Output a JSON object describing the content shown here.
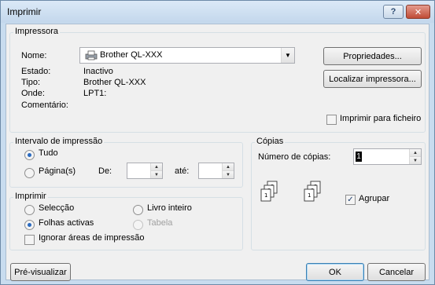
{
  "window": {
    "title": "Imprimir",
    "help_label": "?",
    "close_label": "✕"
  },
  "printer": {
    "group_label": "Impressora",
    "name_label": "Nome:",
    "name_value": "Brother QL-XXX",
    "properties_button": "Propriedades...",
    "find_printer_button": "Localizar impressora...",
    "status_label": "Estado:",
    "status_value": "Inactivo",
    "type_label": "Tipo:",
    "type_value": "Brother QL-XXX",
    "where_label": "Onde:",
    "where_value": "LPT1:",
    "comment_label": "Comentário:",
    "print_to_file_label": "Imprimir para ficheiro",
    "print_to_file_checked": false
  },
  "range": {
    "group_label": "Intervalo de impressão",
    "all_label": "Tudo",
    "all_checked": true,
    "pages_label": "Página(s)",
    "from_label": "De:",
    "from_value": "",
    "to_label": "até:",
    "to_value": ""
  },
  "copies": {
    "group_label": "Cópias",
    "count_label": "Número de cópias:",
    "count_value": "1",
    "collate_label": "Agrupar",
    "collate_checked": true
  },
  "print_what": {
    "group_label": "Imprimir",
    "selection_label": "Selecção",
    "selection_checked": false,
    "workbook_label": "Livro inteiro",
    "workbook_checked": false,
    "active_sheets_label": "Folhas activas",
    "active_sheets_checked": true,
    "table_label": "Tabela",
    "table_enabled": false,
    "ignore_print_areas_label": "Ignorar áreas de impressão",
    "ignore_print_areas_checked": false
  },
  "footer": {
    "preview_button": "Pré-visualizar",
    "ok_button": "OK",
    "cancel_button": "Cancelar"
  },
  "icons": {
    "printer_icon": "printer-icon",
    "collate_icon": "collate-pages-icon"
  }
}
